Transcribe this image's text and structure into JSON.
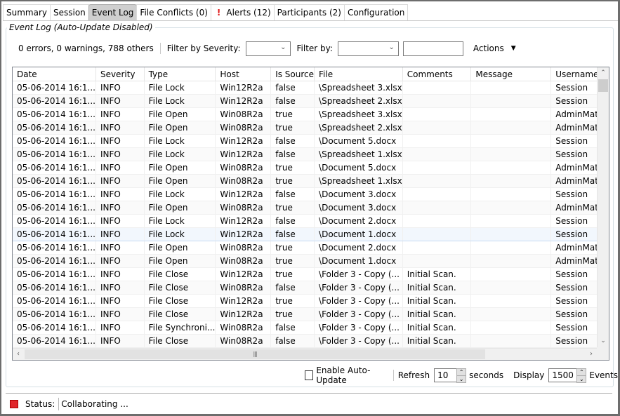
{
  "tabs": [
    {
      "label": "Summary",
      "active": false
    },
    {
      "label": "Session",
      "active": false
    },
    {
      "label": "Event Log",
      "active": true
    },
    {
      "label": "File Conflicts (0)",
      "active": false
    },
    {
      "label": "Alerts (12)",
      "active": false,
      "icon": "exclamation-icon"
    },
    {
      "label": "Participants (2)",
      "active": false
    },
    {
      "label": "Configuration",
      "active": false
    }
  ],
  "group_title": "Event Log (Auto-Update Disabled)",
  "filters": {
    "summary": "0 errors, 0 warnings, 788 others",
    "severity_label": "Filter by Severity:",
    "severity_value": "",
    "filter_by_label": "Filter by:",
    "filter_by_value": "",
    "filter_text": "",
    "actions_label": "Actions"
  },
  "table": {
    "columns": [
      "Date",
      "Severity",
      "Type",
      "Host",
      "Is Source",
      "File",
      "Comments",
      "Message",
      "Username"
    ],
    "rows": [
      [
        "05-06-2014 16:1...",
        "INFO",
        "File Lock",
        "Win12R2a",
        "false",
        "\\Spreadsheet 3.xlsx",
        "",
        "",
        "Session"
      ],
      [
        "05-06-2014 16:1...",
        "INFO",
        "File Lock",
        "Win12R2a",
        "false",
        "\\Spreadsheet 2.xlsx",
        "",
        "",
        "Session"
      ],
      [
        "05-06-2014 16:1...",
        "INFO",
        "File Open",
        "Win08R2a",
        "true",
        "\\Spreadsheet 3.xlsx",
        "",
        "",
        "AdminMat..."
      ],
      [
        "05-06-2014 16:1...",
        "INFO",
        "File Open",
        "Win08R2a",
        "true",
        "\\Spreadsheet 2.xlsx",
        "",
        "",
        "AdminMat..."
      ],
      [
        "05-06-2014 16:1...",
        "INFO",
        "File Lock",
        "Win12R2a",
        "false",
        "\\Document 5.docx",
        "",
        "",
        "Session"
      ],
      [
        "05-06-2014 16:1...",
        "INFO",
        "File Lock",
        "Win12R2a",
        "false",
        "\\Spreadsheet 1.xlsx",
        "",
        "",
        "Session"
      ],
      [
        "05-06-2014 16:1...",
        "INFO",
        "File Open",
        "Win08R2a",
        "true",
        "\\Document 5.docx",
        "",
        "",
        "AdminMat..."
      ],
      [
        "05-06-2014 16:1...",
        "INFO",
        "File Open",
        "Win08R2a",
        "true",
        "\\Spreadsheet 1.xlsx",
        "",
        "",
        "AdminMat..."
      ],
      [
        "05-06-2014 16:1...",
        "INFO",
        "File Lock",
        "Win12R2a",
        "false",
        "\\Document 3.docx",
        "",
        "",
        "Session"
      ],
      [
        "05-06-2014 16:1...",
        "INFO",
        "File Open",
        "Win08R2a",
        "true",
        "\\Document 3.docx",
        "",
        "",
        "AdminMat..."
      ],
      [
        "05-06-2014 16:1...",
        "INFO",
        "File Lock",
        "Win12R2a",
        "false",
        "\\Document 2.docx",
        "",
        "",
        "Session"
      ],
      [
        "05-06-2014 16:1...",
        "INFO",
        "File Lock",
        "Win12R2a",
        "false",
        "\\Document 1.docx",
        "",
        "",
        "Session"
      ],
      [
        "05-06-2014 16:1...",
        "INFO",
        "File Open",
        "Win08R2a",
        "true",
        "\\Document 2.docx",
        "",
        "",
        "AdminMat..."
      ],
      [
        "05-06-2014 16:1...",
        "INFO",
        "File Open",
        "Win08R2a",
        "true",
        "\\Document 1.docx",
        "",
        "",
        "AdminMat..."
      ],
      [
        "05-06-2014 16:1...",
        "INFO",
        "File Close",
        "Win12R2a",
        "true",
        "\\Folder 3 - Copy (...",
        "Initial Scan.",
        "",
        "Session"
      ],
      [
        "05-06-2014 16:1...",
        "INFO",
        "File Close",
        "Win08R2a",
        "false",
        "\\Folder 3 - Copy (...",
        "Initial Scan.",
        "",
        "Session"
      ],
      [
        "05-06-2014 16:1...",
        "INFO",
        "File Close",
        "Win12R2a",
        "true",
        "\\Folder 3 - Copy (...",
        "Initial Scan.",
        "",
        "Session"
      ],
      [
        "05-06-2014 16:1...",
        "INFO",
        "File Close",
        "Win12R2a",
        "true",
        "\\Folder 3 - Copy (...",
        "Initial Scan.",
        "",
        "Session"
      ],
      [
        "05-06-2014 16:1...",
        "INFO",
        "File Synchroni...",
        "Win08R2a",
        "false",
        "\\Folder 3 - Copy (...",
        "Initial Scan.",
        "",
        "Session"
      ],
      [
        "05-06-2014 16:1...",
        "INFO",
        "File Close",
        "Win08R2a",
        "false",
        "\\Folder 3 - Copy (...",
        "Initial Scan.",
        "",
        "Session"
      ]
    ],
    "highlighted_row": 11
  },
  "bottom": {
    "auto_update_label": "Enable Auto-Update",
    "auto_update_checked": false,
    "refresh_label": "Refresh",
    "refresh_value": "10",
    "seconds_label": "seconds",
    "display_label": "Display",
    "display_value": "1500",
    "events_label": "Events"
  },
  "status": {
    "label": "Status:",
    "value": "Collaborating ...",
    "color": "#e0262b"
  }
}
